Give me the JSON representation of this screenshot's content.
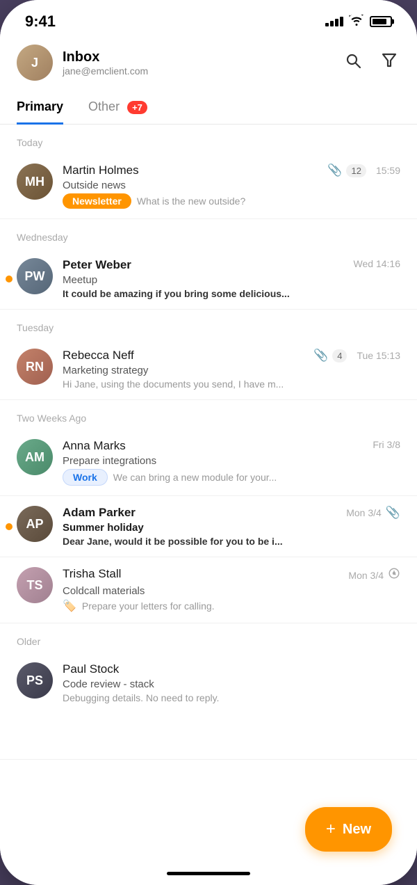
{
  "status": {
    "time": "9:41"
  },
  "header": {
    "title": "Inbox",
    "subtitle": "jane@emclient.com",
    "avatar_initials": "J"
  },
  "tabs": [
    {
      "label": "Primary",
      "active": true
    },
    {
      "label": "Other",
      "active": false,
      "badge": "+7"
    }
  ],
  "sections": [
    {
      "title": "Today",
      "emails": [
        {
          "sender": "Martin Holmes",
          "subject": "Outside news",
          "preview": "What is the new outside?",
          "time": "15:59",
          "tag": "Newsletter",
          "tag_type": "newsletter",
          "attachment_count": "12",
          "unread": false,
          "avatar_initials": "MH",
          "avatar_class": "av-martin"
        }
      ]
    },
    {
      "title": "Wednesday",
      "emails": [
        {
          "sender": "Peter Weber",
          "subject": "Meetup",
          "preview": "It could be amazing if you bring some delicious...",
          "time": "Wed 14:16",
          "unread": true,
          "bold": true,
          "avatar_initials": "PW",
          "avatar_class": "av-peter"
        }
      ]
    },
    {
      "title": "Tuesday",
      "emails": [
        {
          "sender": "Rebecca Neff",
          "subject": "Marketing strategy",
          "preview": "Hi Jane, using the documents you send, I have m...",
          "time": "Tue 15:13",
          "attachment_count": "4",
          "unread": false,
          "avatar_initials": "RN",
          "avatar_class": "av-rebecca"
        }
      ]
    },
    {
      "title": "Two Weeks Ago",
      "emails": [
        {
          "sender": "Anna Marks",
          "subject": "Prepare integrations",
          "preview": "We can bring a new module for your...",
          "time": "Fri 3/8",
          "tag": "Work",
          "tag_type": "work",
          "unread": false,
          "avatar_initials": "AM",
          "avatar_class": "av-anna"
        },
        {
          "sender": "Adam Parker",
          "subject": "Summer holiday",
          "preview": "Dear Jane, would it be possible for you to be i...",
          "time": "Mon 3/4",
          "attachment_only": true,
          "unread": true,
          "bold": true,
          "avatar_initials": "AP",
          "avatar_class": "av-adam"
        },
        {
          "sender": "Trisha Stall",
          "subject": "Coldcall materials",
          "preview": "Prepare your letters for calling.",
          "time": "Mon 3/4",
          "flag": true,
          "schedule": true,
          "unread": false,
          "avatar_initials": "TS",
          "avatar_class": "av-trisha"
        }
      ]
    },
    {
      "title": "Older",
      "emails": [
        {
          "sender": "Paul Stock",
          "subject": "Code review - stack",
          "preview": "Debugging details. No need to reply.",
          "time": "",
          "unread": false,
          "avatar_initials": "PS",
          "avatar_class": "av-paul"
        }
      ]
    }
  ],
  "fab": {
    "label": "New",
    "plus": "+"
  }
}
